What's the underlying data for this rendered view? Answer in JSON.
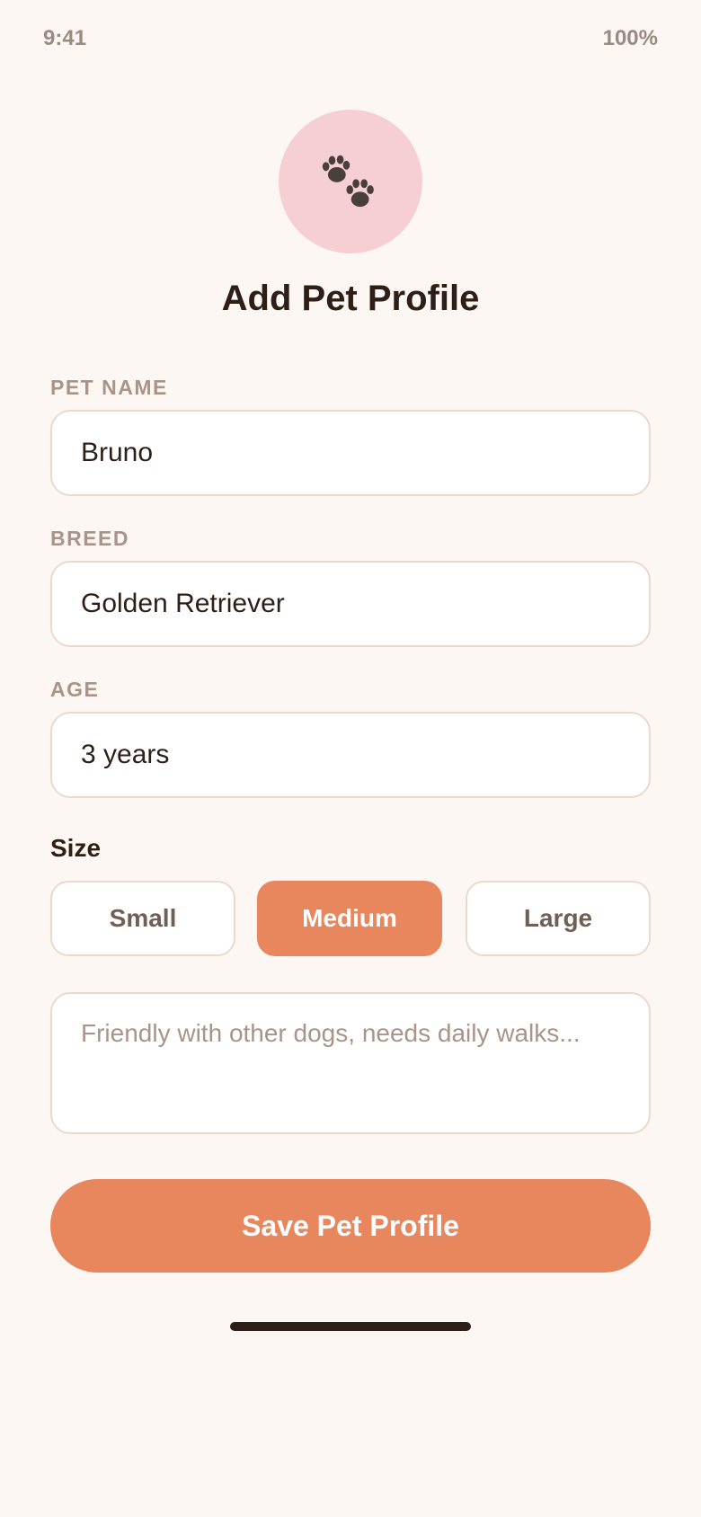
{
  "status_bar": {
    "time": "9:41",
    "battery": "100%"
  },
  "header": {
    "avatar_icon": "paw-prints-icon",
    "title": "Add Pet Profile"
  },
  "form": {
    "pet_name": {
      "label": "PET NAME",
      "value": "Bruno"
    },
    "breed": {
      "label": "BREED",
      "value": "Golden Retriever"
    },
    "age": {
      "label": "AGE",
      "value": "3 years"
    },
    "size": {
      "label": "Size",
      "options": [
        "Small",
        "Medium",
        "Large"
      ],
      "selected": "Medium"
    },
    "notes": {
      "value": "",
      "placeholder": "Friendly with other dogs, needs daily walks..."
    },
    "save_label": "Save Pet Profile"
  },
  "colors": {
    "background": "#fdf7f3",
    "accent": "#e8865e",
    "avatar_bg": "#f6cfd5",
    "label": "#a89488",
    "text": "#2d1f18"
  }
}
